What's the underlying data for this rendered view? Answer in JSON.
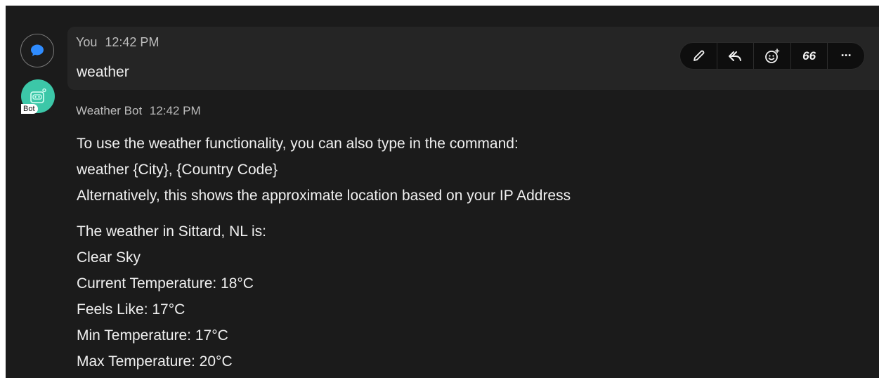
{
  "messages": [
    {
      "author": "You",
      "time": "12:42 PM",
      "text": "weather"
    },
    {
      "author": "Weather Bot",
      "time": "12:42 PM",
      "badge": "Bot",
      "lines_intro": [
        "To use the weather functionality, you can also type in the command:",
        "weather {City}, {Country Code}",
        "Alternatively, this shows the approximate location based on your IP Address"
      ],
      "lines_report": [
        "The weather in Sittard, NL is:",
        "Clear Sky",
        "Current Temperature: 18°C",
        "Feels Like: 17°C",
        "Min Temperature: 17°C",
        "Max Temperature: 20°C"
      ]
    }
  ],
  "toolbar": {
    "icons": [
      "edit-pencil-icon",
      "reply-icon",
      "add-reaction-icon",
      "quote-icon",
      "more-icon"
    ],
    "quote_glyph": "66",
    "more_glyph": "···"
  },
  "colors": {
    "background": "#1b1b1b",
    "hover_row": "#252525",
    "bot_avatar": "#3cc7a8"
  }
}
